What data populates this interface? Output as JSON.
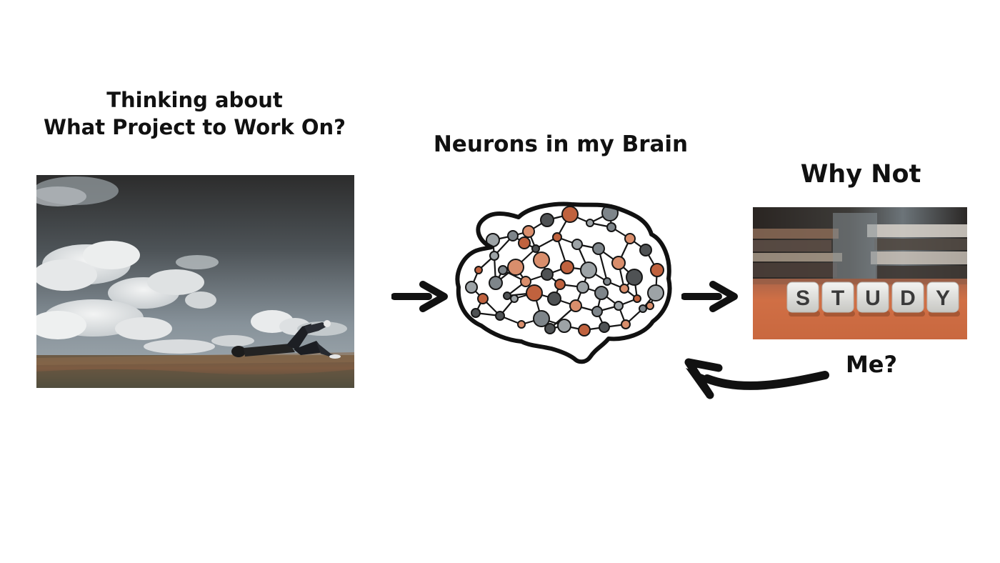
{
  "captions": {
    "thinking_line1": "Thinking about",
    "thinking_line2": "What Project to Work On?",
    "neurons": "Neurons in my Brain",
    "why_not": "Why Not",
    "me": "Me?"
  },
  "study_dice": {
    "letters": [
      "S",
      "T",
      "U",
      "D",
      "Y"
    ]
  },
  "colors": {
    "text": "#111111",
    "arrow": "#111111",
    "neuron_orange": "#c0623e",
    "neuron_gray": "#7e858a",
    "neuron_dark": "#4f5254",
    "table_orange": "#d36f45"
  }
}
